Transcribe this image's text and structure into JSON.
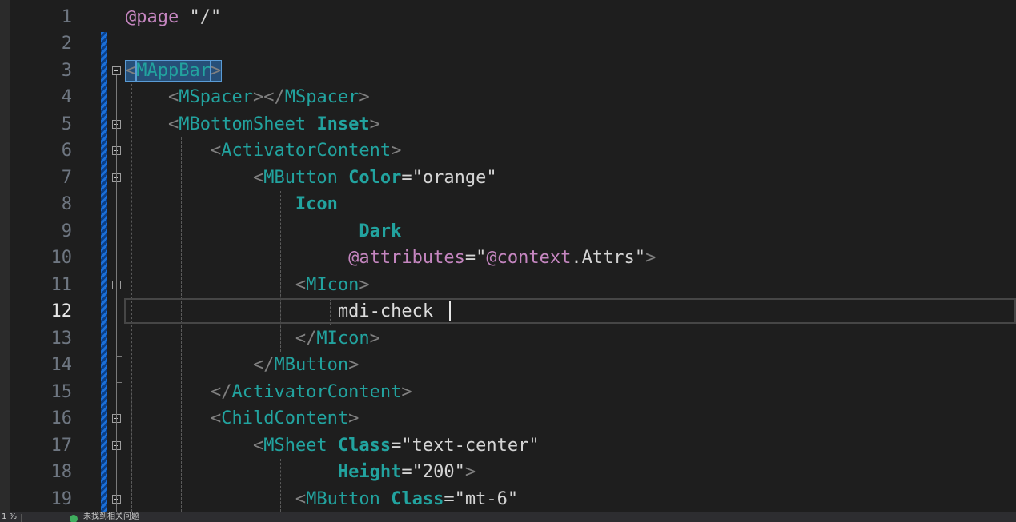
{
  "editor": {
    "current_line": 12,
    "lines": [
      {
        "n": "1",
        "tokens": [
          {
            "c": "t-razor",
            "t": "@page"
          },
          {
            "c": "t-plain",
            "t": " "
          },
          {
            "c": "t-str",
            "t": "\"/\""
          }
        ]
      },
      {
        "n": "2",
        "tokens": []
      },
      {
        "n": "3",
        "tokens": [
          {
            "c": "t-punct t-sel",
            "t": "<"
          },
          {
            "c": "t-tag t-sel",
            "t": "MAppBar"
          },
          {
            "c": "t-punct t-sel",
            "t": ">"
          }
        ]
      },
      {
        "n": "4",
        "tokens": [
          {
            "c": "t-plain",
            "t": "    "
          },
          {
            "c": "t-punct",
            "t": "<"
          },
          {
            "c": "t-tag",
            "t": "MSpacer"
          },
          {
            "c": "t-punct",
            "t": "></"
          },
          {
            "c": "t-tag",
            "t": "MSpacer"
          },
          {
            "c": "t-punct",
            "t": ">"
          }
        ]
      },
      {
        "n": "5",
        "tokens": [
          {
            "c": "t-plain",
            "t": "    "
          },
          {
            "c": "t-punct",
            "t": "<"
          },
          {
            "c": "t-tag",
            "t": "MBottomSheet"
          },
          {
            "c": "t-plain",
            "t": " "
          },
          {
            "c": "t-attr",
            "t": "Inset"
          },
          {
            "c": "t-punct",
            "t": ">"
          }
        ]
      },
      {
        "n": "6",
        "tokens": [
          {
            "c": "t-plain",
            "t": "        "
          },
          {
            "c": "t-punct",
            "t": "<"
          },
          {
            "c": "t-tag",
            "t": "ActivatorContent"
          },
          {
            "c": "t-punct",
            "t": ">"
          }
        ]
      },
      {
        "n": "7",
        "tokens": [
          {
            "c": "t-plain",
            "t": "            "
          },
          {
            "c": "t-punct",
            "t": "<"
          },
          {
            "c": "t-tag",
            "t": "MButton"
          },
          {
            "c": "t-plain",
            "t": " "
          },
          {
            "c": "t-attr",
            "t": "Color"
          },
          {
            "c": "t-plain",
            "t": "="
          },
          {
            "c": "t-str",
            "t": "\"orange\""
          }
        ]
      },
      {
        "n": "8",
        "tokens": [
          {
            "c": "t-plain",
            "t": "                "
          },
          {
            "c": "t-attr",
            "t": "Icon"
          }
        ]
      },
      {
        "n": "9",
        "tokens": [
          {
            "c": "t-plain",
            "t": "                      "
          },
          {
            "c": "t-attr",
            "t": "Dark"
          }
        ]
      },
      {
        "n": "10",
        "tokens": [
          {
            "c": "t-plain",
            "t": "                     "
          },
          {
            "c": "t-razor",
            "t": "@attributes"
          },
          {
            "c": "t-plain",
            "t": "="
          },
          {
            "c": "t-str",
            "t": "\""
          },
          {
            "c": "t-razor",
            "t": "@context"
          },
          {
            "c": "t-plain",
            "t": ".Attrs"
          },
          {
            "c": "t-str",
            "t": "\""
          },
          {
            "c": "t-punct",
            "t": ">"
          }
        ]
      },
      {
        "n": "11",
        "tokens": [
          {
            "c": "t-plain",
            "t": "                "
          },
          {
            "c": "t-punct",
            "t": "<"
          },
          {
            "c": "t-tag",
            "t": "MIcon"
          },
          {
            "c": "t-punct",
            "t": ">"
          }
        ]
      },
      {
        "n": "12",
        "tokens": [
          {
            "c": "t-plain",
            "t": "                    "
          },
          {
            "c": "t-text",
            "t": "mdi-check"
          }
        ]
      },
      {
        "n": "13",
        "tokens": [
          {
            "c": "t-plain",
            "t": "                "
          },
          {
            "c": "t-punct",
            "t": "</"
          },
          {
            "c": "t-tag",
            "t": "MIcon"
          },
          {
            "c": "t-punct",
            "t": ">"
          }
        ]
      },
      {
        "n": "14",
        "tokens": [
          {
            "c": "t-plain",
            "t": "            "
          },
          {
            "c": "t-punct",
            "t": "</"
          },
          {
            "c": "t-tag",
            "t": "MButton"
          },
          {
            "c": "t-punct",
            "t": ">"
          }
        ]
      },
      {
        "n": "15",
        "tokens": [
          {
            "c": "t-plain",
            "t": "        "
          },
          {
            "c": "t-punct",
            "t": "</"
          },
          {
            "c": "t-tag",
            "t": "ActivatorContent"
          },
          {
            "c": "t-punct",
            "t": ">"
          }
        ]
      },
      {
        "n": "16",
        "tokens": [
          {
            "c": "t-plain",
            "t": "        "
          },
          {
            "c": "t-punct",
            "t": "<"
          },
          {
            "c": "t-tag",
            "t": "ChildContent"
          },
          {
            "c": "t-punct",
            "t": ">"
          }
        ]
      },
      {
        "n": "17",
        "tokens": [
          {
            "c": "t-plain",
            "t": "            "
          },
          {
            "c": "t-punct",
            "t": "<"
          },
          {
            "c": "t-tag",
            "t": "MSheet"
          },
          {
            "c": "t-plain",
            "t": " "
          },
          {
            "c": "t-attr",
            "t": "Class"
          },
          {
            "c": "t-plain",
            "t": "="
          },
          {
            "c": "t-str",
            "t": "\"text-center\""
          }
        ]
      },
      {
        "n": "18",
        "tokens": [
          {
            "c": "t-plain",
            "t": "                    "
          },
          {
            "c": "t-attr",
            "t": "Height"
          },
          {
            "c": "t-plain",
            "t": "="
          },
          {
            "c": "t-str",
            "t": "\"200\""
          },
          {
            "c": "t-punct",
            "t": ">"
          }
        ]
      },
      {
        "n": "19",
        "tokens": [
          {
            "c": "t-plain",
            "t": "                "
          },
          {
            "c": "t-punct",
            "t": "<"
          },
          {
            "c": "t-tag",
            "t": "MButton"
          },
          {
            "c": "t-plain",
            "t": " "
          },
          {
            "c": "t-attr",
            "t": "Class"
          },
          {
            "c": "t-plain",
            "t": "="
          },
          {
            "c": "t-str",
            "t": "\"mt-6\""
          }
        ]
      }
    ],
    "fold_lines": [
      3,
      5,
      6,
      7,
      11,
      16,
      17,
      19
    ]
  },
  "status_bar": {
    "zoom": "1 %",
    "issues_icon": "check-circle-icon",
    "issues_text": "未找到相关问题"
  },
  "colors": {
    "background": "#1e1e1e",
    "tag": "#22a39f",
    "razor": "#c586c0",
    "change_bar": "#1b6fd8"
  }
}
